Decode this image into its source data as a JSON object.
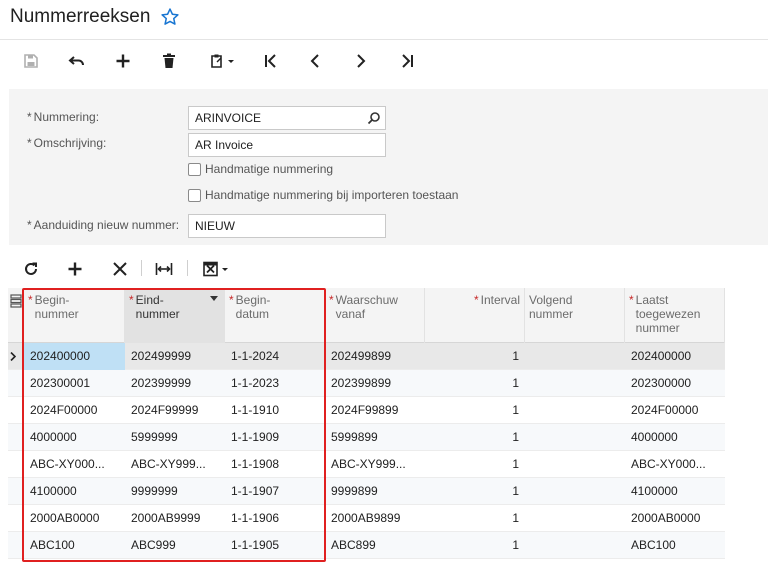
{
  "header": {
    "title": "Nummerreeksen"
  },
  "form": {
    "nummering_label": "Nummering:",
    "nummering_value": "ARINVOICE",
    "omschrijving_label": "Omschrijving:",
    "omschrijving_value": "AR Invoice",
    "handmatig_label": "Handmatige nummering",
    "handmatig_import_label": "Handmatige nummering bij importeren toestaan",
    "aanduiding_label": "Aanduiding nieuw nummer:",
    "aanduiding_value": "NIEUW"
  },
  "grid": {
    "headers": [
      {
        "l1": "Begin-",
        "l2": "nummer",
        "l3": ""
      },
      {
        "l1": "Eind-",
        "l2": "nummer",
        "l3": ""
      },
      {
        "l1": "Begin-",
        "l2": "datum",
        "l3": ""
      },
      {
        "l1": "Waarschuw",
        "l2": "vanaf",
        "l3": ""
      },
      {
        "l1": "Interval",
        "l2": "",
        "l3": ""
      },
      {
        "l1": "Volgend",
        "l2": "nummer",
        "l3": ""
      },
      {
        "l1": "Laatst",
        "l2": "toegewezen",
        "l3": "nummer"
      }
    ],
    "rows": [
      {
        "begin": "202400000",
        "eind": "202499999",
        "datum": "1-1-2024",
        "waarschuw": "202499899",
        "interval": "1",
        "volgend": "",
        "laatst": "202400000"
      },
      {
        "begin": "202300001",
        "eind": "202399999",
        "datum": "1-1-2023",
        "waarschuw": "202399899",
        "interval": "1",
        "volgend": "",
        "laatst": "202300000"
      },
      {
        "begin": "2024F00000",
        "eind": "2024F99999",
        "datum": "1-1-1910",
        "waarschuw": "2024F99899",
        "interval": "1",
        "volgend": "",
        "laatst": "2024F00000"
      },
      {
        "begin": "4000000",
        "eind": "5999999",
        "datum": "1-1-1909",
        "waarschuw": "5999899",
        "interval": "1",
        "volgend": "",
        "laatst": "4000000"
      },
      {
        "begin": "ABC-XY000...",
        "eind": "ABC-XY999...",
        "datum": "1-1-1908",
        "waarschuw": "ABC-XY999...",
        "interval": "1",
        "volgend": "",
        "laatst": "ABC-XY000..."
      },
      {
        "begin": "4100000",
        "eind": "9999999",
        "datum": "1-1-1907",
        "waarschuw": "9999899",
        "interval": "1",
        "volgend": "",
        "laatst": "4100000"
      },
      {
        "begin": "2000AB0000",
        "eind": "2000AB9999",
        "datum": "1-1-1906",
        "waarschuw": "2000AB9899",
        "interval": "1",
        "volgend": "",
        "laatst": "2000AB0000"
      },
      {
        "begin": "ABC100",
        "eind": "ABC999",
        "datum": "1-1-1905",
        "waarschuw": "ABC899",
        "interval": "1",
        "volgend": "",
        "laatst": "ABC100"
      }
    ]
  },
  "colors": {
    "required": "#c62828",
    "highlight": "#e02020",
    "selected_cell": "#bfe0f5",
    "accent": "#1976d2"
  },
  "icons": [
    "star-icon",
    "save-icon",
    "undo-icon",
    "add-icon",
    "delete-icon",
    "clipboard-icon",
    "first-icon",
    "prev-icon",
    "next-icon",
    "last-icon",
    "search-icon",
    "refresh-icon",
    "close-icon",
    "fit-columns-icon",
    "export-icon"
  ]
}
